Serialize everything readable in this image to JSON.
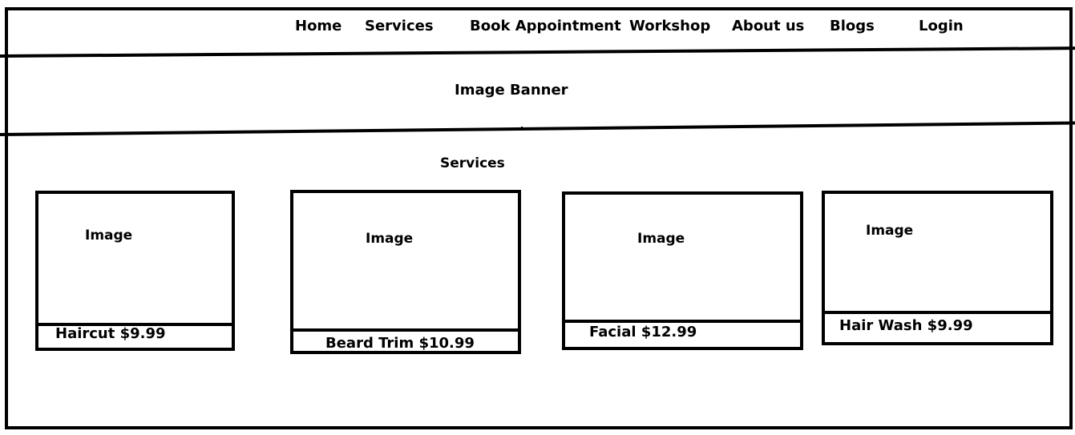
{
  "nav": {
    "items": [
      {
        "label": "Home"
      },
      {
        "label": "Services"
      },
      {
        "label": "Book Appointment"
      },
      {
        "label": "Workshop"
      },
      {
        "label": "About us"
      },
      {
        "label": "Blogs"
      },
      {
        "label": "Login"
      }
    ]
  },
  "banner": {
    "label": "Image Banner"
  },
  "services": {
    "title": "Services",
    "cards": [
      {
        "image_label": "Image",
        "caption": "Haircut $9.99"
      },
      {
        "image_label": "Image",
        "caption": "Beard Trim $10.99"
      },
      {
        "image_label": "Image",
        "caption": "Facial $12.99"
      },
      {
        "image_label": "Image",
        "caption": "Hair Wash $9.99"
      }
    ]
  }
}
